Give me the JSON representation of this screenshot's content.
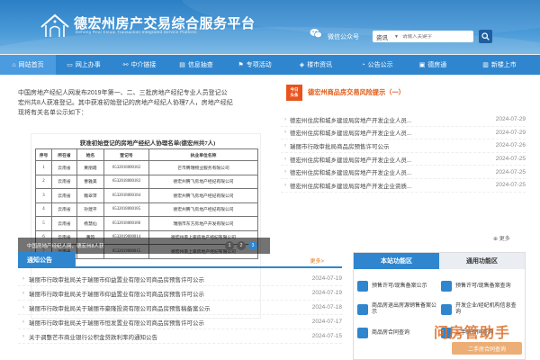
{
  "header": {
    "title": "德宏州房产交易综合服务平台",
    "subtitle": "Dehong Real Estate Transaction Integrated Service Platform",
    "wechat_label": "微信公众号",
    "search_select": "资讯",
    "search_placeholder": "请输入关键字"
  },
  "nav": [
    {
      "label": "网站首页",
      "icon": "home-icon"
    },
    {
      "label": "网上办事",
      "icon": "monitor-icon"
    },
    {
      "label": "中介链接",
      "icon": "link-icon"
    },
    {
      "label": "信息抽查",
      "icon": "document-icon"
    },
    {
      "label": "专项活动",
      "icon": "flag-icon"
    },
    {
      "label": "楼市资讯",
      "icon": "news-icon"
    },
    {
      "label": "公告公示",
      "icon": "bell-icon"
    },
    {
      "label": "德房通",
      "icon": "app-icon"
    },
    {
      "label": "新楼上市",
      "icon": "building-icon"
    }
  ],
  "slider": {
    "lines": [
      "中国房地产经纪人网发布2019年第一、二、三批房地产经纪专业人员登记公",
      "宏州共8人获准登记。其中获准初始登记的房地产经纪人协理7人，房地产经纪",
      "现将有关名单公示如下："
    ],
    "doc_title": "获准初始登记的房地产经纪人协理名单(德宏州共7人)",
    "doc_headers": [
      "序号",
      "所在省",
      "姓名",
      "登记号",
      "执业单位名称"
    ],
    "doc_rows": [
      [
        "1",
        "云南省",
        "黄丽霞",
        "6532018000182",
        "芒市腾瑞物业服务有限公司"
      ],
      [
        "2",
        "云南省",
        "曹雅美",
        "6532018000183",
        "德宏州腾飞房地产经纪有限公司"
      ],
      [
        "3",
        "云南省",
        "魏翠萍",
        "6532018000184",
        "德宏州腾飞房地产经纪有限公司"
      ],
      [
        "4",
        "云南省",
        "孙建平",
        "6532018000185",
        "德宏州腾飞房地产经纪有限公司"
      ],
      [
        "5",
        "云南省",
        "杨慧仙",
        "6532018000186",
        "瑞丽市东方房地产开发有限公司"
      ],
      [
        "6",
        "云南省",
        "黄韵",
        "6532019000014",
        "德宏州景上家房地产经纪有限公司"
      ],
      [
        "7",
        "云南省",
        "",
        "6532019000015",
        "德宏州景上家房地产经纪有限公司"
      ]
    ],
    "caption": "中国房地产经纪人网，德宏州8人获",
    "dots": [
      "1",
      "2",
      "3"
    ]
  },
  "risk": {
    "badge_top": "今日",
    "badge_bottom": "头条",
    "title": "德宏州商品房交易风险提示（一）",
    "items": [
      {
        "title": "德宏州住房和城乡建设局房地产开发企业人员...",
        "date": "2024-07-29"
      },
      {
        "title": "德宏州住房和城乡建设局房地产开发企业人员...",
        "date": "2024-07-29"
      },
      {
        "title": "瑞丽市行政审批局商品房预售许可公示",
        "date": "2024-07-26"
      },
      {
        "title": "德宏州住房和城乡建设局房地产开发企业人员...",
        "date": "2024-07-25"
      },
      {
        "title": "德宏州住房和城乡建设局房地产开发企业人员...",
        "date": "2024-07-25"
      },
      {
        "title": "德宏州住房和城乡建设局房地产开发企业资质...",
        "date": "2024-07-25"
      }
    ],
    "more": "更多"
  },
  "notice": {
    "tab": "通知公告",
    "more": "更多>",
    "items": [
      {
        "title": "瑞丽市行政审批局关于瑞丽市仰益置业有限公司商品房预售许可公示",
        "date": "2024-07-19"
      },
      {
        "title": "瑞丽市行政审批局关于瑞丽市仰益置业有限公司商品房预售许可公示",
        "date": "2024-07-19"
      },
      {
        "title": "瑞丽市行政审批局关于瑞丽市豪隆投资有限公司商品房预售稿备案公示",
        "date": "2024-07-18"
      },
      {
        "title": "瑞丽市行政审批局关于瑞丽市恒发置业有限公司商品房预售许可公示",
        "date": "2024-07-17"
      },
      {
        "title": "关于调整芒市商业银行公积金贷款利率的通知公告",
        "date": "2024-07-15"
      }
    ]
  },
  "funcs": {
    "tabs": [
      "本站功能区",
      "通用功能区"
    ],
    "items": [
      {
        "label": "预售许可/现售备案公示"
      },
      {
        "label": "预售许可/现售备案查询"
      },
      {
        "label": "商品房退出房源销售备案公示"
      },
      {
        "label": "开发企业/经纪机构信息查询"
      },
      {
        "label": "商品房合同查询"
      },
      {
        "label": "二手房合同查询"
      }
    ]
  },
  "watermark": {
    "text": "问房管助手",
    "sub": "二手房合同查询"
  },
  "colors": {
    "brand_blue": "#2f86cf",
    "nav_blue": "#2f86cf",
    "accent_orange": "#e15a16"
  }
}
